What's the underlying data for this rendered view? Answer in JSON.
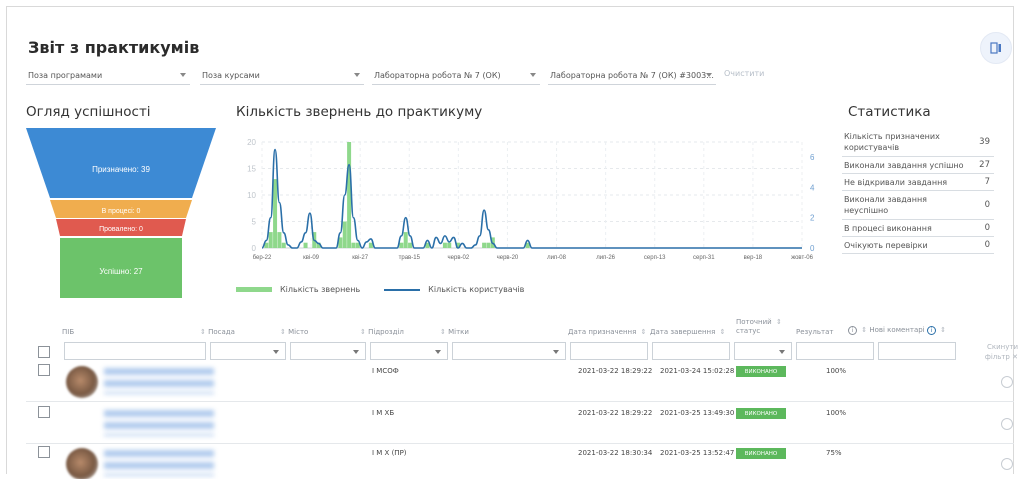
{
  "header": {
    "title": "Звіт з практикумів"
  },
  "filters": [
    {
      "value": "Поза програмами"
    },
    {
      "value": "Поза курсами"
    },
    {
      "value": "Лабораторна робота № 7 (ОК)"
    },
    {
      "value": "Лабораторна робота № 7 (ОК) #3003..."
    }
  ],
  "clear_filters_label": "Очистити",
  "overview": {
    "title": "Огляд успішності",
    "funnel": [
      {
        "label": "Призначено: 39",
        "color": "#3d8ad4"
      },
      {
        "label": "В процесі: 0",
        "color": "#f0ad4e"
      },
      {
        "label": "Провалено: 0",
        "color": "#e05a4f"
      },
      {
        "label": "Успішно: 27",
        "color": "#6cc36a"
      }
    ]
  },
  "chart_section": {
    "title": "Кількість звернень до практикуму"
  },
  "chart_data": {
    "type": "line",
    "x_ticks": [
      "бер-22",
      "кві-09",
      "кві-27",
      "трав-15",
      "черв-02",
      "черв-20",
      "лип-08",
      "лип-26",
      "серп-13",
      "серп-31",
      "вер-18",
      "жовт-06"
    ],
    "y_left_ticks": [
      0,
      5,
      10,
      15,
      20
    ],
    "y_right_ticks": [
      0,
      2,
      4,
      6
    ],
    "ylim_left": [
      0,
      20
    ],
    "ylim_right": [
      0,
      7
    ],
    "series": [
      {
        "name": "Кількість звернень",
        "type": "bar",
        "color": "#8fd88c",
        "values": [
          0,
          1,
          3,
          13,
          3,
          1,
          0,
          0,
          0,
          0,
          1,
          0,
          3,
          1,
          0,
          0,
          0,
          0,
          2,
          5,
          20,
          1,
          1,
          0,
          0,
          1,
          0,
          0,
          0,
          0,
          0,
          0,
          1,
          3,
          1,
          0,
          0,
          0,
          1,
          0,
          0,
          0,
          1,
          1,
          0,
          1,
          0,
          0,
          0,
          0,
          0,
          1,
          1,
          2,
          0,
          0,
          0,
          0,
          0,
          0,
          0,
          1,
          0
        ]
      },
      {
        "name": "Кількість користувачів",
        "type": "line",
        "color": "#2a6fa8",
        "values": [
          0,
          0.5,
          2,
          6.5,
          3,
          1,
          0.2,
          0,
          0,
          0.4,
          1,
          2.3,
          0.5,
          0.3,
          0,
          0,
          0,
          0,
          1,
          3.5,
          5.5,
          2,
          0.5,
          0,
          0.4,
          0.6,
          0,
          0,
          0,
          0,
          0,
          0,
          0.8,
          2,
          0.8,
          0,
          0,
          0,
          0.5,
          0,
          0.7,
          0.3,
          0.8,
          0.4,
          0.7,
          0,
          0.3,
          0,
          0,
          0.2,
          0.8,
          2.5,
          1.2,
          0.3,
          0,
          0,
          0,
          0,
          0,
          0,
          0,
          0.5,
          0
        ]
      }
    ],
    "x_rest": 0,
    "grid": true,
    "legend": "bottom"
  },
  "statistics": {
    "title": "Статистика",
    "rows": [
      {
        "label": "Кількість призначених користувачів",
        "value": "39"
      },
      {
        "label": "Виконали завдання успішно",
        "value": "27"
      },
      {
        "label": "Не відкривали завдання",
        "value": "7"
      },
      {
        "label": "Виконали завдання неуспішно",
        "value": "0"
      },
      {
        "label": "В процесі виконання",
        "value": "0"
      },
      {
        "label": "Очікують перевірки",
        "value": "0"
      }
    ]
  },
  "table": {
    "columns": {
      "pib": "ПІБ",
      "position": "Посада",
      "city": "Місто",
      "department": "Підрозділ",
      "tags": "Мітки",
      "assigned": "Дата призначення",
      "completed": "Дата завершення",
      "status_l1": "Поточний",
      "status_l2": "статус",
      "result": "Результат",
      "new_comments": "Нові коментарі"
    },
    "reset_l1": "Скинути",
    "reset_l2": "фільтр",
    "rows": [
      {
        "department": "I МСОФ",
        "assigned": "2021-03-22 18:29:22",
        "completed": "2021-03-24 15:02:28",
        "status": "ВИКОНАНО",
        "result": "100%"
      },
      {
        "department": "I М ХБ",
        "assigned": "2021-03-22 18:29:22",
        "completed": "2021-03-25 13:49:30",
        "status": "ВИКОНАНО",
        "result": "100%"
      },
      {
        "department": "I М Х (ПР)",
        "assigned": "2021-03-22 18:30:34",
        "completed": "2021-03-25 13:52:47",
        "status": "ВИКОНАНО",
        "result": "75%"
      }
    ]
  }
}
